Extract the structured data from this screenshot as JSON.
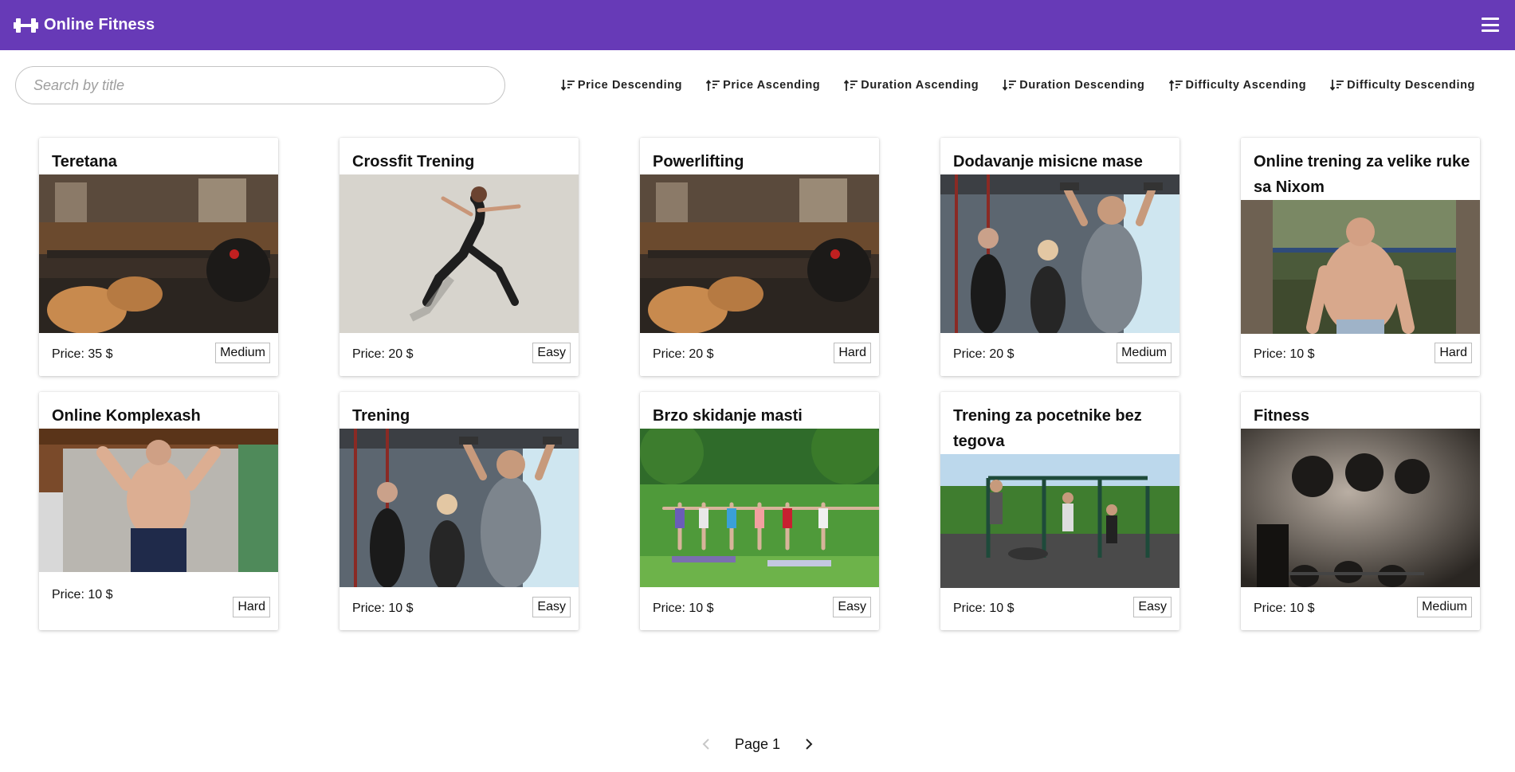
{
  "app": {
    "title": "Online Fitness",
    "brand_icon": "dumbbell-icon",
    "menu_icon": "hamburger-icon",
    "accent": "#673ab7"
  },
  "search": {
    "placeholder": "Search by title",
    "value": ""
  },
  "sort_buttons": [
    {
      "label": "Price Descending",
      "icon": "sort-descending-icon"
    },
    {
      "label": "Price Ascending",
      "icon": "sort-ascending-icon"
    },
    {
      "label": "Duration Ascending",
      "icon": "sort-ascending-icon"
    },
    {
      "label": "Duration Descending",
      "icon": "sort-descending-icon"
    },
    {
      "label": "Difficulty Ascending",
      "icon": "sort-ascending-icon"
    },
    {
      "label": "Difficulty Descending",
      "icon": "sort-descending-icon"
    }
  ],
  "programs": [
    {
      "title": "Teretana",
      "price": "Price: 35 $",
      "difficulty": "Medium",
      "image": "gym-interior"
    },
    {
      "title": "Crossfit Trening",
      "price": "Price: 20 $",
      "difficulty": "Easy",
      "image": "woman-jumping"
    },
    {
      "title": "Powerlifting",
      "price": "Price: 20 $",
      "difficulty": "Hard",
      "image": "gym-interior"
    },
    {
      "title": "Dodavanje misicne mase",
      "price": "Price: 20 $",
      "difficulty": "Medium",
      "image": "dumbbell-class"
    },
    {
      "title": "Online trening za velike ruke sa Nixom",
      "price": "Price: 10 $",
      "difficulty": "Hard",
      "image": "man-outdoors"
    },
    {
      "title": "Online Komplexash",
      "price": "Price: 10 $",
      "difficulty": "Hard",
      "image": "man-garage"
    },
    {
      "title": "Trening",
      "price": "Price: 10 $",
      "difficulty": "Easy",
      "image": "dumbbell-class"
    },
    {
      "title": "Brzo skidanje masti",
      "price": "Price: 10 $",
      "difficulty": "Easy",
      "image": "park-yoga"
    },
    {
      "title": "Trening za pocetnike bez tegova",
      "price": "Price: 10 $",
      "difficulty": "Easy",
      "image": "outdoor-bars"
    },
    {
      "title": "Fitness",
      "price": "Price: 10 $",
      "difficulty": "Medium",
      "image": "dumbbell-rack"
    }
  ],
  "pagination": {
    "label": "Page 1",
    "prev_icon": "chevron-left-icon",
    "next_icon": "chevron-right-icon"
  }
}
